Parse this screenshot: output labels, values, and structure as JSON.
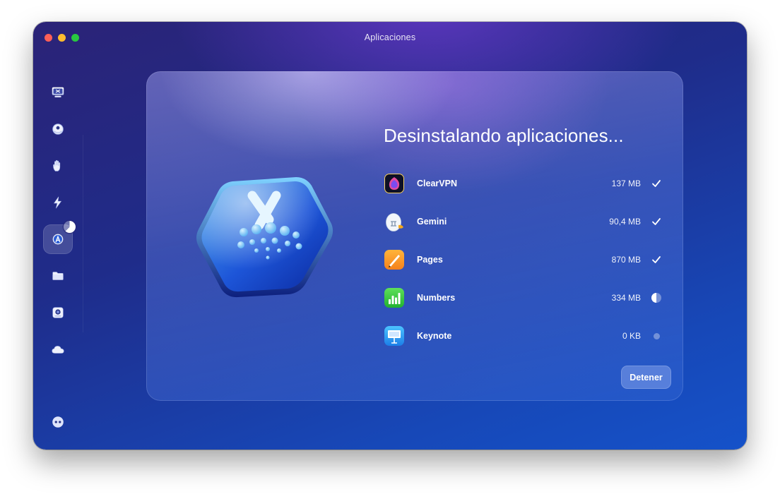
{
  "window": {
    "title": "Aplicaciones",
    "traffic_lights": [
      "#fe5f57",
      "#febc2e",
      "#28c840"
    ]
  },
  "sidebar": {
    "items": [
      {
        "id": "smart-care",
        "icon": "monitor-icon",
        "active": false
      },
      {
        "id": "cleanup",
        "icon": "bubble-ball-icon",
        "active": false
      },
      {
        "id": "protection",
        "icon": "hand-icon",
        "active": false
      },
      {
        "id": "performance",
        "icon": "lightning-icon",
        "active": false
      },
      {
        "id": "applications",
        "icon": "app-store-a-icon",
        "active": true,
        "badge": "progress-pie-icon"
      },
      {
        "id": "my-clutter",
        "icon": "folder-icon",
        "active": false
      },
      {
        "id": "space-lens",
        "icon": "lens-disk-icon",
        "active": false
      },
      {
        "id": "cloud",
        "icon": "cloud-icon",
        "active": false
      }
    ],
    "footer_icon": "assistant-icon"
  },
  "panel": {
    "heading": "Desinstalando aplicaciones...",
    "hero_icon": "uninstaller-hexagon-icon",
    "apps": [
      {
        "name": "ClearVPN",
        "size": "137 MB",
        "status": "done",
        "icon": "clearvpn-icon"
      },
      {
        "name": "Gemini",
        "size": "90,4 MB",
        "status": "done",
        "icon": "gemini-icon"
      },
      {
        "name": "Pages",
        "size": "870 MB",
        "status": "done",
        "icon": "pages-icon"
      },
      {
        "name": "Numbers",
        "size": "334 MB",
        "status": "in-progress",
        "progress": 0.5,
        "icon": "numbers-icon"
      },
      {
        "name": "Keynote",
        "size": "0 KB",
        "status": "pending",
        "icon": "keynote-icon"
      }
    ],
    "stop_label": "Detener"
  },
  "colors": {
    "accent": "#1552c9",
    "window_gradient_top": "#2b2377",
    "window_gradient_bottom": "#1552c9"
  }
}
